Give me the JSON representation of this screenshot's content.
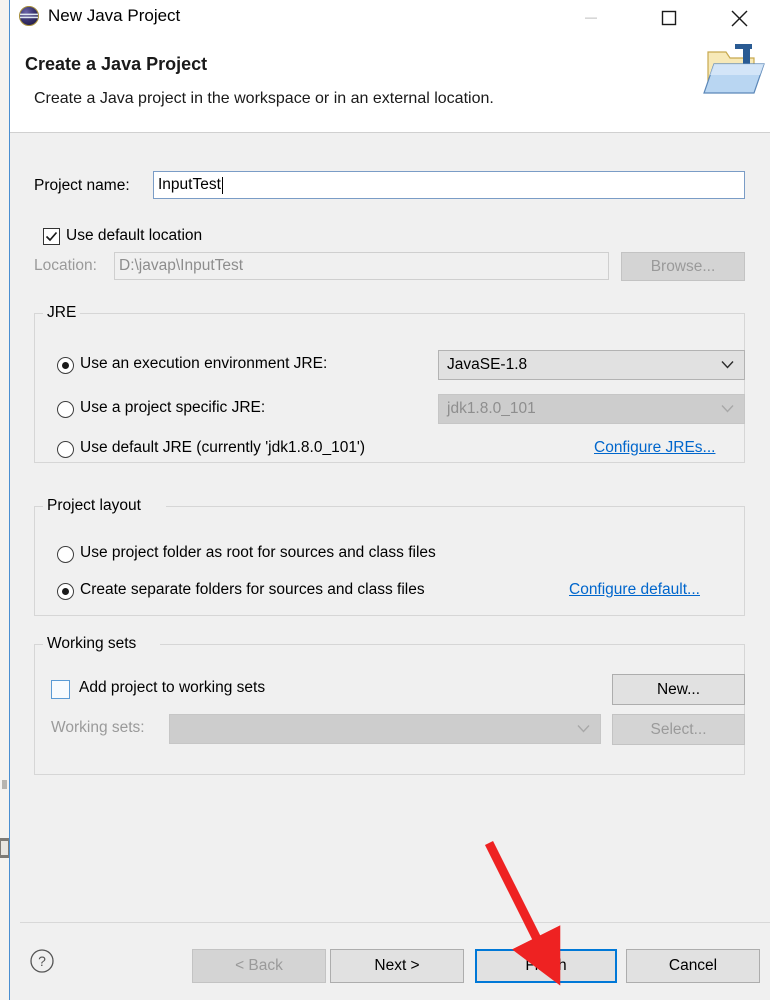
{
  "window": {
    "title": "New Java Project",
    "icon": "java-project-icon",
    "controls": {
      "minimize": "minimize-button",
      "maximize": "maximize-button",
      "close": "close-button"
    }
  },
  "header": {
    "title": "Create a Java Project",
    "description": "Create a Java project in the workspace or in an external location.",
    "icon": "new-java-project-wizard-icon"
  },
  "form": {
    "project_name_label": "Project name:",
    "project_name_value": "InputTest",
    "project_name_placeholder": "",
    "use_default_location_label": "Use default location",
    "use_default_location_checked": true,
    "location_label": "Location:",
    "location_value": "D:\\javap\\InputTest",
    "location_enabled": false,
    "browse_label": "Browse...",
    "browse_enabled": false
  },
  "jre": {
    "group_label": "JRE",
    "options": [
      {
        "label": "Use an execution environment JRE:",
        "selected": true
      },
      {
        "label": "Use a project specific JRE:",
        "selected": false
      },
      {
        "label": "Use default JRE (currently 'jdk1.8.0_101')",
        "selected": false
      }
    ],
    "execution_env_value": "JavaSE-1.8",
    "execution_env_enabled": true,
    "project_jre_value": "jdk1.8.0_101",
    "project_jre_enabled": false,
    "configure_link": "Configure JREs..."
  },
  "project_layout": {
    "group_label": "Project layout",
    "options": [
      {
        "label": "Use project folder as root for sources and class files",
        "selected": false
      },
      {
        "label": "Create separate folders for sources and class files",
        "selected": true
      }
    ],
    "configure_link": "Configure default..."
  },
  "working_sets": {
    "group_label": "Working sets",
    "add_to_working_sets_label": "Add project to working sets",
    "add_to_working_sets_checked": false,
    "working_sets_label": "Working sets:",
    "working_sets_value": "",
    "working_sets_enabled": false,
    "new_label": "New...",
    "new_enabled": true,
    "select_label": "Select...",
    "select_enabled": false
  },
  "footer": {
    "help_icon": "help-icon",
    "buttons": [
      {
        "label": "< Back",
        "enabled": false,
        "focused": false
      },
      {
        "label": "Next >",
        "enabled": true,
        "focused": false
      },
      {
        "label": "Finish",
        "enabled": true,
        "focused": true
      },
      {
        "label": "Cancel",
        "enabled": true,
        "focused": false
      }
    ]
  },
  "annotation": {
    "type": "arrow",
    "color": "#ee2222",
    "points_to": "Finish"
  },
  "colors": {
    "dialog_background": "#f0f0f0",
    "header_background": "#ffffff",
    "accent_focus": "#0078d7",
    "link": "#0066cc",
    "annotation_red": "#ee2222"
  }
}
